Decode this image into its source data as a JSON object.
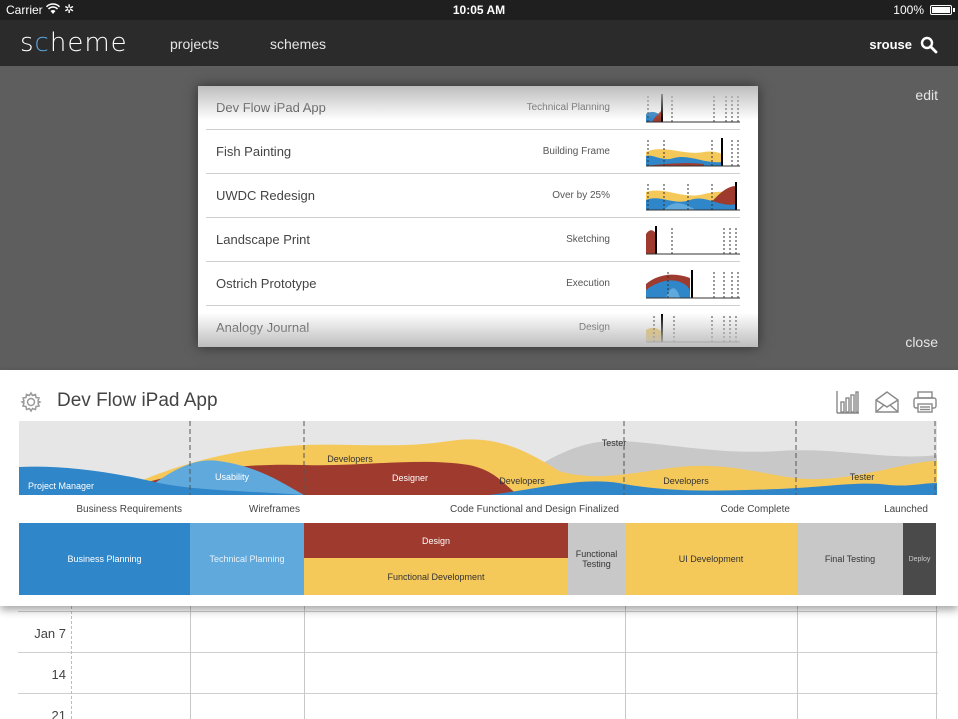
{
  "status_bar": {
    "carrier": "Carrier",
    "time": "10:05 AM",
    "battery": "100%"
  },
  "nav": {
    "logo": "scheme",
    "links": [
      "projects",
      "schemes"
    ],
    "user": "srouse"
  },
  "overlay": {
    "edit_label": "edit",
    "close_label": "close"
  },
  "projects": [
    {
      "name": "Dev Flow iPad App",
      "status": "Technical Planning"
    },
    {
      "name": "Fish Painting",
      "status": "Building Frame"
    },
    {
      "name": "UWDC Redesign",
      "status": "Over by 25%"
    },
    {
      "name": "Landscape Print",
      "status": "Sketching"
    },
    {
      "name": "Ostrich Prototype",
      "status": "Execution"
    },
    {
      "name": "Analogy Journal",
      "status": "Design"
    }
  ],
  "detail": {
    "title": "Dev Flow iPad App",
    "flow_labels": [
      "Project Manager",
      "Usability",
      "Developers",
      "Designer",
      "Developers",
      "Tester",
      "Developers",
      "Tester"
    ],
    "milestones": [
      "Business Requirements",
      "Wireframes",
      "Code Functional and Design Finalized",
      "Code Complete",
      "Launched"
    ],
    "phases": [
      "Business Planning",
      "Technical Planning",
      "Design",
      "Functional Development",
      "Functional Testing",
      "UI Development",
      "Final Testing",
      "Deploy"
    ]
  },
  "calendar": {
    "rows": [
      "Jan 7",
      "14",
      "21"
    ]
  },
  "colors": {
    "blue": "#2f86c9",
    "light_blue": "#5fa9dd",
    "yellow": "#f5c85a",
    "red": "#9e3a2e",
    "gray": "#c8c8c8",
    "dark_gray": "#4a4a4a",
    "flow_bg": "#e6e6e6"
  }
}
